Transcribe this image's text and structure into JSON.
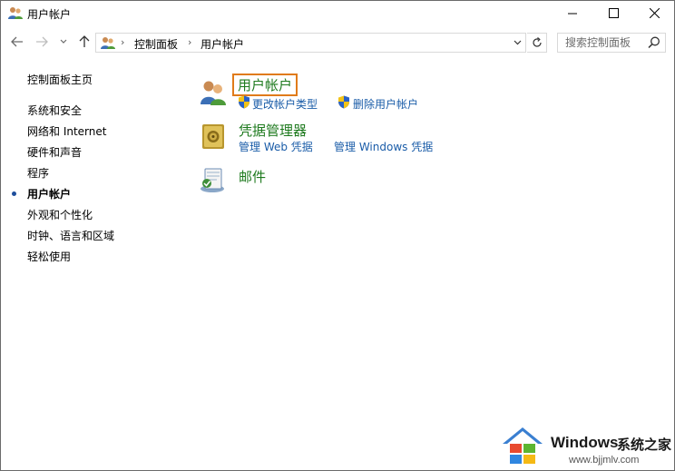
{
  "window": {
    "title": "用户帐户",
    "icon": "users-icon"
  },
  "navigation": {
    "breadcrumbs": [
      "控制面板",
      "用户帐户"
    ],
    "search_placeholder": "搜索控制面板"
  },
  "sidebar": {
    "home": "控制面板主页",
    "items": [
      {
        "label": "系统和安全",
        "active": false
      },
      {
        "label": "网络和 Internet",
        "active": false
      },
      {
        "label": "硬件和声音",
        "active": false
      },
      {
        "label": "程序",
        "active": false
      },
      {
        "label": "用户帐户",
        "active": true
      },
      {
        "label": "外观和个性化",
        "active": false
      },
      {
        "label": "时钟、语言和区域",
        "active": false
      },
      {
        "label": "轻松使用",
        "active": false
      }
    ]
  },
  "categories": [
    {
      "title": "用户帐户",
      "icon": "user-accounts-icon",
      "highlighted": true,
      "links": [
        "更改帐户类型",
        "删除用户帐户"
      ]
    },
    {
      "title": "凭据管理器",
      "icon": "credential-vault-icon",
      "links": [
        "管理 Web 凭据",
        "管理 Windows 凭据"
      ]
    },
    {
      "title": "邮件",
      "icon": "mail-icon",
      "links": []
    }
  ],
  "watermark": {
    "brand": "Windows",
    "brand_cn": "系统之家",
    "url": "www.bjjmlv.com"
  },
  "colors": {
    "category_title": "#1e7a1e",
    "link": "#1a5ca8",
    "highlight_border": "#e07b1a",
    "active_bullet": "#1e4e9c"
  }
}
